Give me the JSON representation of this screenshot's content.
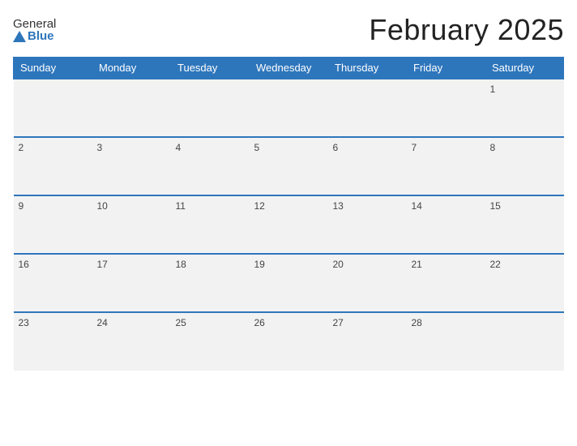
{
  "header": {
    "logo_general": "General",
    "logo_blue": "Blue",
    "month_title": "February 2025"
  },
  "weekdays": [
    "Sunday",
    "Monday",
    "Tuesday",
    "Wednesday",
    "Thursday",
    "Friday",
    "Saturday"
  ],
  "weeks": [
    [
      "",
      "",
      "",
      "",
      "",
      "",
      "1"
    ],
    [
      "2",
      "3",
      "4",
      "5",
      "6",
      "7",
      "8"
    ],
    [
      "9",
      "10",
      "11",
      "12",
      "13",
      "14",
      "15"
    ],
    [
      "16",
      "17",
      "18",
      "19",
      "20",
      "21",
      "22"
    ],
    [
      "23",
      "24",
      "25",
      "26",
      "27",
      "28",
      ""
    ]
  ]
}
